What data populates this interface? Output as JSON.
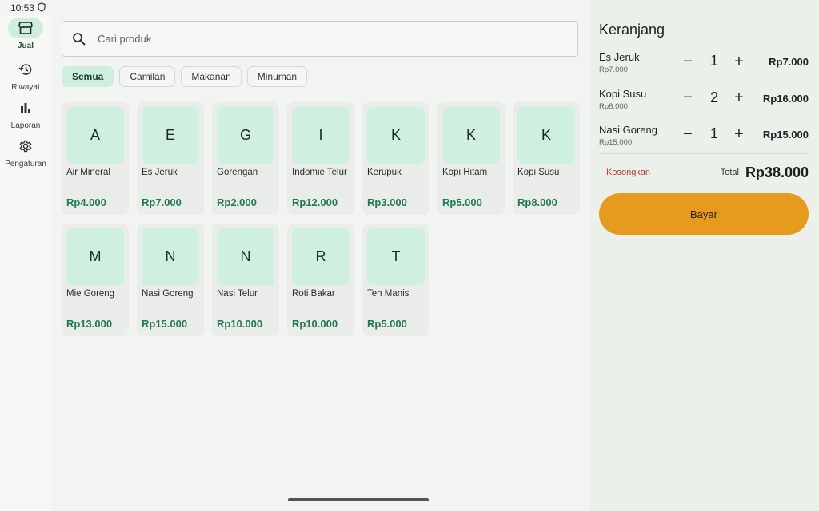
{
  "status_bar": {
    "time": "10:53"
  },
  "nav": [
    {
      "label": "Jual",
      "icon": "storefront-icon",
      "active": true
    },
    {
      "label": "Riwayat",
      "icon": "history-icon",
      "active": false
    },
    {
      "label": "Laporan",
      "icon": "bar-chart-icon",
      "active": false
    },
    {
      "label": "Pengaturan",
      "icon": "gear-icon",
      "active": false
    }
  ],
  "search": {
    "placeholder": "Cari produk",
    "value": ""
  },
  "categories": [
    "Semua",
    "Camilan",
    "Makanan",
    "Minuman"
  ],
  "selected_category": "Semua",
  "products": [
    {
      "initial": "A",
      "name": "Air Mineral",
      "price": "Rp4.000"
    },
    {
      "initial": "E",
      "name": "Es Jeruk",
      "price": "Rp7.000"
    },
    {
      "initial": "G",
      "name": "Gorengan",
      "price": "Rp2.000"
    },
    {
      "initial": "I",
      "name": "Indomie Telur",
      "price": "Rp12.000"
    },
    {
      "initial": "K",
      "name": "Kerupuk",
      "price": "Rp3.000"
    },
    {
      "initial": "K",
      "name": "Kopi Hitam",
      "price": "Rp5.000"
    },
    {
      "initial": "K",
      "name": "Kopi Susu",
      "price": "Rp8.000"
    },
    {
      "initial": "M",
      "name": "Mie Goreng",
      "price": "Rp13.000"
    },
    {
      "initial": "N",
      "name": "Nasi Goreng",
      "price": "Rp15.000"
    },
    {
      "initial": "N",
      "name": "Nasi Telur",
      "price": "Rp10.000"
    },
    {
      "initial": "R",
      "name": "Roti Bakar",
      "price": "Rp10.000"
    },
    {
      "initial": "T",
      "name": "Teh Manis",
      "price": "Rp5.000"
    }
  ],
  "cart": {
    "title": "Keranjang",
    "items": [
      {
        "name": "Es Jeruk",
        "unit_price": "Rp7.000",
        "qty": "1",
        "subtotal": "Rp7.000"
      },
      {
        "name": "Kopi Susu",
        "unit_price": "Rp8.000",
        "qty": "2",
        "subtotal": "Rp16.000"
      },
      {
        "name": "Nasi Goreng",
        "unit_price": "Rp15.000",
        "qty": "1",
        "subtotal": "Rp15.000"
      }
    ],
    "clear_label": "Kosongkan",
    "total_label": "Total",
    "total_value": "Rp38.000",
    "pay_label": "Bayar"
  },
  "colors": {
    "accent_green": "#1f7a4f",
    "tile_green": "#cff0de",
    "pay_orange": "#e69b1e",
    "clear_red": "#c0392b"
  }
}
